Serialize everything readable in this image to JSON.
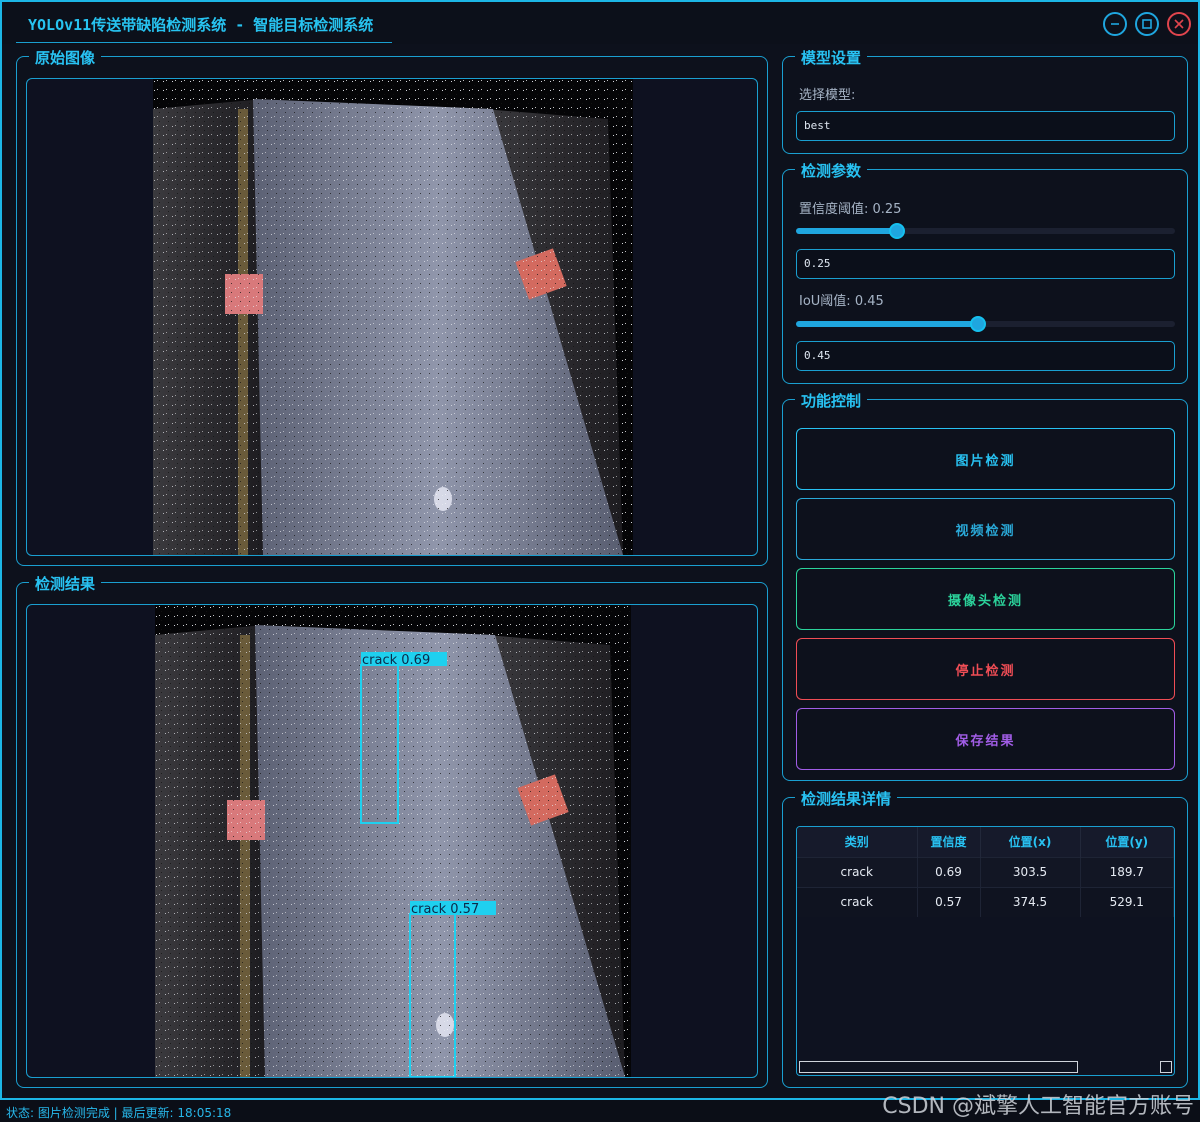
{
  "window": {
    "title": "YOLOv11传送带缺陷检测系统 - 智能目标检测系统",
    "minimize_icon": "minimize-icon",
    "maximize_icon": "maximize-icon",
    "close_icon": "close-icon"
  },
  "original_panel": {
    "title": "原始图像"
  },
  "result_panel": {
    "title": "检测结果",
    "detections": [
      {
        "label": "crack 0.69",
        "color": "#1fd0ef"
      },
      {
        "label": "crack 0.57",
        "color": "#1fd0ef"
      }
    ]
  },
  "model_settings": {
    "title": "模型设置",
    "select_label": "选择模型:",
    "selected_model": "best"
  },
  "detect_params": {
    "title": "检测参数",
    "confidence_label": "置信度阈值: 0.25",
    "confidence_value": "0.25",
    "confidence_fraction": 0.25,
    "iou_label": "IoU阈值: 0.45",
    "iou_value": "0.45",
    "iou_fraction": 0.45
  },
  "controls": {
    "title": "功能控制",
    "buttons": [
      {
        "label": "图片检测",
        "color": "#28c2f2"
      },
      {
        "label": "视频检测",
        "color": "#2aa9d8"
      },
      {
        "label": "摄像头检测",
        "color": "#2bd39b"
      },
      {
        "label": "停止检测",
        "color": "#ef4d55"
      },
      {
        "label": "保存结果",
        "color": "#a15de6"
      }
    ]
  },
  "results_table": {
    "title": "检测结果详情",
    "headers": [
      "类别",
      "置信度",
      "位置(x)",
      "位置(y)"
    ],
    "rows": [
      [
        "crack",
        "0.69",
        "303.5",
        "189.7"
      ],
      [
        "crack",
        "0.57",
        "374.5",
        "529.1"
      ]
    ]
  },
  "statusbar": {
    "text": "状态: 图片检测完成 | 最后更新: 18:05:18"
  },
  "watermark": "CSDN @斌擎人工智能官方账号",
  "colors": {
    "accent": "#1fa6df",
    "background": "#0d111c"
  }
}
